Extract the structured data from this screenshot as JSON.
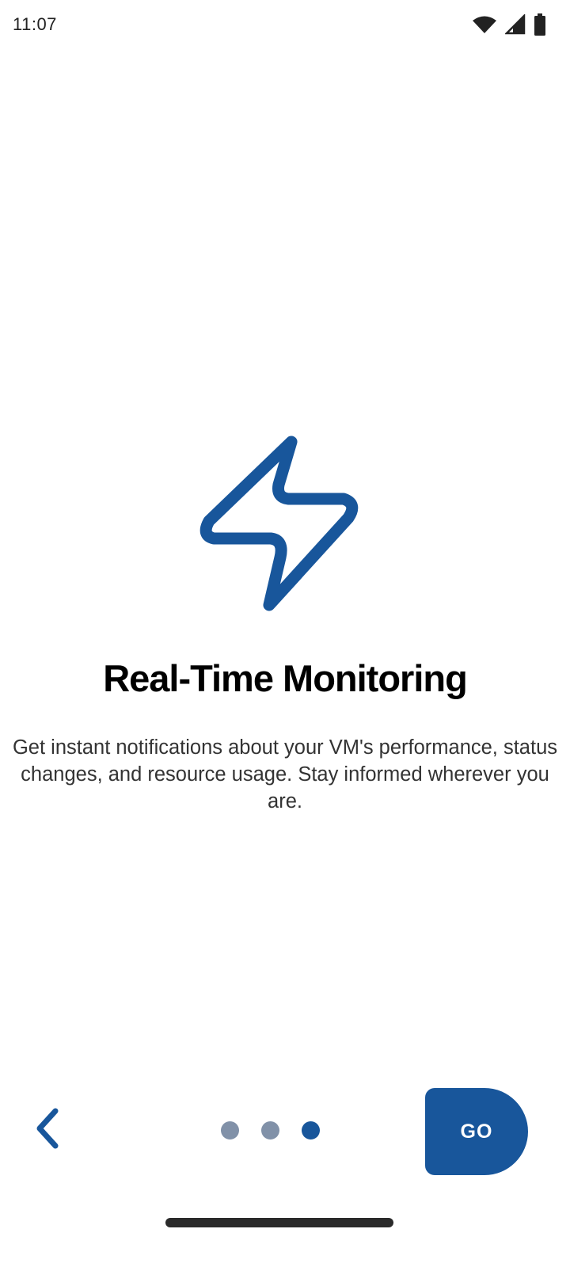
{
  "status_bar": {
    "time": "11:07",
    "icons": [
      "wifi-icon",
      "signal-icon",
      "battery-icon"
    ]
  },
  "onboarding": {
    "hero_icon": "lightning-bolt-icon",
    "title": "Real-Time Monitoring",
    "description": "Get instant notifications about your VM's performance, status changes, and resource usage. Stay informed wherever you are."
  },
  "navigation": {
    "back_icon": "chevron-left-icon",
    "page_count": 3,
    "current_page": 3,
    "go_label": "GO"
  },
  "colors": {
    "accent": "#18569b",
    "inactive_dot": "#8191a8",
    "title": "#000000",
    "body_text": "#333333",
    "background": "#ffffff"
  }
}
